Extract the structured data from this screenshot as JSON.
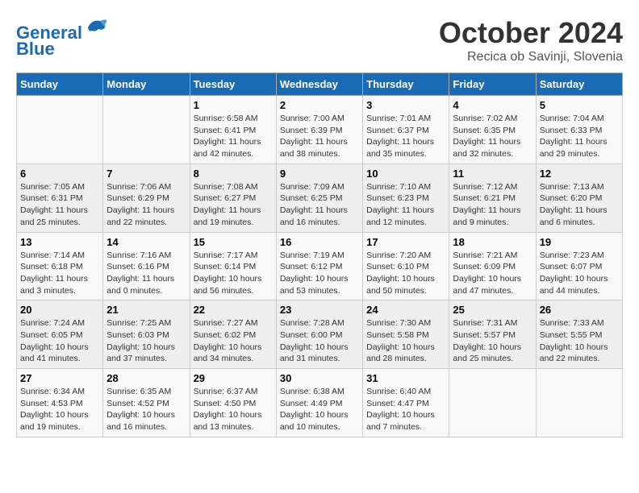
{
  "header": {
    "logo_line1": "General",
    "logo_line2": "Blue",
    "month": "October 2024",
    "location": "Recica ob Savinji, Slovenia"
  },
  "weekdays": [
    "Sunday",
    "Monday",
    "Tuesday",
    "Wednesday",
    "Thursday",
    "Friday",
    "Saturday"
  ],
  "weeks": [
    [
      {
        "day": "",
        "sunrise": "",
        "sunset": "",
        "daylight": ""
      },
      {
        "day": "",
        "sunrise": "",
        "sunset": "",
        "daylight": ""
      },
      {
        "day": "1",
        "sunrise": "Sunrise: 6:58 AM",
        "sunset": "Sunset: 6:41 PM",
        "daylight": "Daylight: 11 hours and 42 minutes."
      },
      {
        "day": "2",
        "sunrise": "Sunrise: 7:00 AM",
        "sunset": "Sunset: 6:39 PM",
        "daylight": "Daylight: 11 hours and 38 minutes."
      },
      {
        "day": "3",
        "sunrise": "Sunrise: 7:01 AM",
        "sunset": "Sunset: 6:37 PM",
        "daylight": "Daylight: 11 hours and 35 minutes."
      },
      {
        "day": "4",
        "sunrise": "Sunrise: 7:02 AM",
        "sunset": "Sunset: 6:35 PM",
        "daylight": "Daylight: 11 hours and 32 minutes."
      },
      {
        "day": "5",
        "sunrise": "Sunrise: 7:04 AM",
        "sunset": "Sunset: 6:33 PM",
        "daylight": "Daylight: 11 hours and 29 minutes."
      }
    ],
    [
      {
        "day": "6",
        "sunrise": "Sunrise: 7:05 AM",
        "sunset": "Sunset: 6:31 PM",
        "daylight": "Daylight: 11 hours and 25 minutes."
      },
      {
        "day": "7",
        "sunrise": "Sunrise: 7:06 AM",
        "sunset": "Sunset: 6:29 PM",
        "daylight": "Daylight: 11 hours and 22 minutes."
      },
      {
        "day": "8",
        "sunrise": "Sunrise: 7:08 AM",
        "sunset": "Sunset: 6:27 PM",
        "daylight": "Daylight: 11 hours and 19 minutes."
      },
      {
        "day": "9",
        "sunrise": "Sunrise: 7:09 AM",
        "sunset": "Sunset: 6:25 PM",
        "daylight": "Daylight: 11 hours and 16 minutes."
      },
      {
        "day": "10",
        "sunrise": "Sunrise: 7:10 AM",
        "sunset": "Sunset: 6:23 PM",
        "daylight": "Daylight: 11 hours and 12 minutes."
      },
      {
        "day": "11",
        "sunrise": "Sunrise: 7:12 AM",
        "sunset": "Sunset: 6:21 PM",
        "daylight": "Daylight: 11 hours and 9 minutes."
      },
      {
        "day": "12",
        "sunrise": "Sunrise: 7:13 AM",
        "sunset": "Sunset: 6:20 PM",
        "daylight": "Daylight: 11 hours and 6 minutes."
      }
    ],
    [
      {
        "day": "13",
        "sunrise": "Sunrise: 7:14 AM",
        "sunset": "Sunset: 6:18 PM",
        "daylight": "Daylight: 11 hours and 3 minutes."
      },
      {
        "day": "14",
        "sunrise": "Sunrise: 7:16 AM",
        "sunset": "Sunset: 6:16 PM",
        "daylight": "Daylight: 11 hours and 0 minutes."
      },
      {
        "day": "15",
        "sunrise": "Sunrise: 7:17 AM",
        "sunset": "Sunset: 6:14 PM",
        "daylight": "Daylight: 10 hours and 56 minutes."
      },
      {
        "day": "16",
        "sunrise": "Sunrise: 7:19 AM",
        "sunset": "Sunset: 6:12 PM",
        "daylight": "Daylight: 10 hours and 53 minutes."
      },
      {
        "day": "17",
        "sunrise": "Sunrise: 7:20 AM",
        "sunset": "Sunset: 6:10 PM",
        "daylight": "Daylight: 10 hours and 50 minutes."
      },
      {
        "day": "18",
        "sunrise": "Sunrise: 7:21 AM",
        "sunset": "Sunset: 6:09 PM",
        "daylight": "Daylight: 10 hours and 47 minutes."
      },
      {
        "day": "19",
        "sunrise": "Sunrise: 7:23 AM",
        "sunset": "Sunset: 6:07 PM",
        "daylight": "Daylight: 10 hours and 44 minutes."
      }
    ],
    [
      {
        "day": "20",
        "sunrise": "Sunrise: 7:24 AM",
        "sunset": "Sunset: 6:05 PM",
        "daylight": "Daylight: 10 hours and 41 minutes."
      },
      {
        "day": "21",
        "sunrise": "Sunrise: 7:25 AM",
        "sunset": "Sunset: 6:03 PM",
        "daylight": "Daylight: 10 hours and 37 minutes."
      },
      {
        "day": "22",
        "sunrise": "Sunrise: 7:27 AM",
        "sunset": "Sunset: 6:02 PM",
        "daylight": "Daylight: 10 hours and 34 minutes."
      },
      {
        "day": "23",
        "sunrise": "Sunrise: 7:28 AM",
        "sunset": "Sunset: 6:00 PM",
        "daylight": "Daylight: 10 hours and 31 minutes."
      },
      {
        "day": "24",
        "sunrise": "Sunrise: 7:30 AM",
        "sunset": "Sunset: 5:58 PM",
        "daylight": "Daylight: 10 hours and 28 minutes."
      },
      {
        "day": "25",
        "sunrise": "Sunrise: 7:31 AM",
        "sunset": "Sunset: 5:57 PM",
        "daylight": "Daylight: 10 hours and 25 minutes."
      },
      {
        "day": "26",
        "sunrise": "Sunrise: 7:33 AM",
        "sunset": "Sunset: 5:55 PM",
        "daylight": "Daylight: 10 hours and 22 minutes."
      }
    ],
    [
      {
        "day": "27",
        "sunrise": "Sunrise: 6:34 AM",
        "sunset": "Sunset: 4:53 PM",
        "daylight": "Daylight: 10 hours and 19 minutes."
      },
      {
        "day": "28",
        "sunrise": "Sunrise: 6:35 AM",
        "sunset": "Sunset: 4:52 PM",
        "daylight": "Daylight: 10 hours and 16 minutes."
      },
      {
        "day": "29",
        "sunrise": "Sunrise: 6:37 AM",
        "sunset": "Sunset: 4:50 PM",
        "daylight": "Daylight: 10 hours and 13 minutes."
      },
      {
        "day": "30",
        "sunrise": "Sunrise: 6:38 AM",
        "sunset": "Sunset: 4:49 PM",
        "daylight": "Daylight: 10 hours and 10 minutes."
      },
      {
        "day": "31",
        "sunrise": "Sunrise: 6:40 AM",
        "sunset": "Sunset: 4:47 PM",
        "daylight": "Daylight: 10 hours and 7 minutes."
      },
      {
        "day": "",
        "sunrise": "",
        "sunset": "",
        "daylight": ""
      },
      {
        "day": "",
        "sunrise": "",
        "sunset": "",
        "daylight": ""
      }
    ]
  ]
}
